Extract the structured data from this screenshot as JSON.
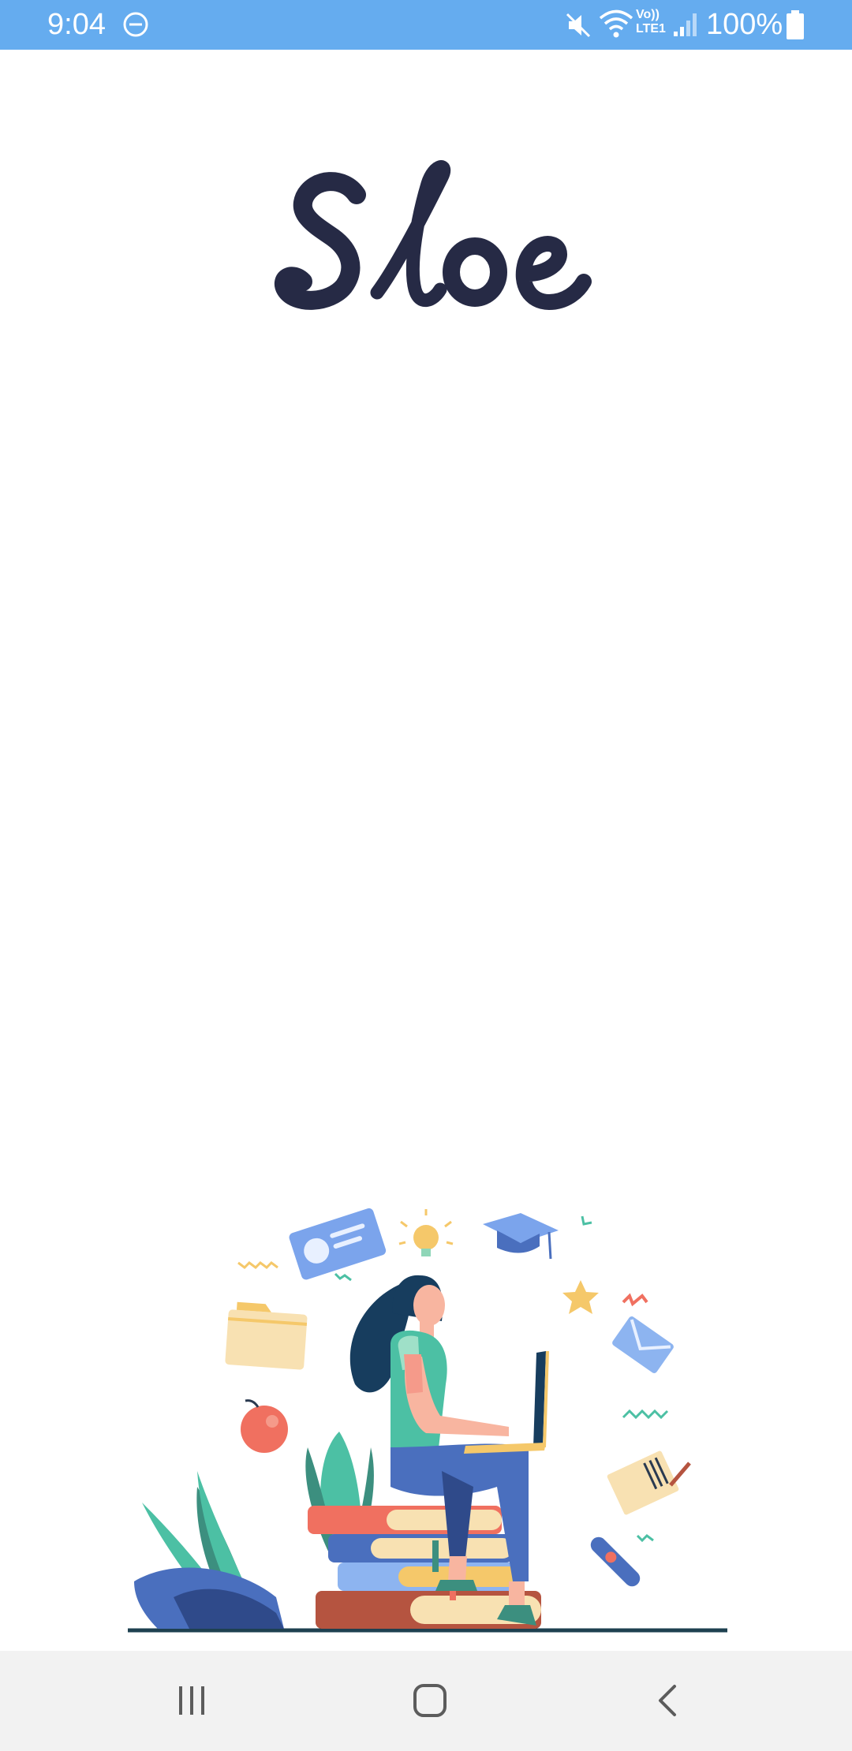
{
  "status_bar": {
    "time": "9:04",
    "battery_percent": "100%",
    "volte_label_top": "Vo))",
    "volte_label_bottom": "LTE1",
    "icons": [
      "do-not-disturb-icon",
      "mute-icon",
      "wifi-icon",
      "volte-icon",
      "signal-icon",
      "battery-icon"
    ]
  },
  "splash": {
    "logo_text": "Sloe",
    "illustration": "woman-on-books-with-laptop"
  },
  "nav_bar": {
    "buttons": [
      "recent-apps",
      "home",
      "back"
    ]
  },
  "colors": {
    "status_bar": "#65acef",
    "logo": "#262a45",
    "nav_bar": "#f2f2f2"
  }
}
